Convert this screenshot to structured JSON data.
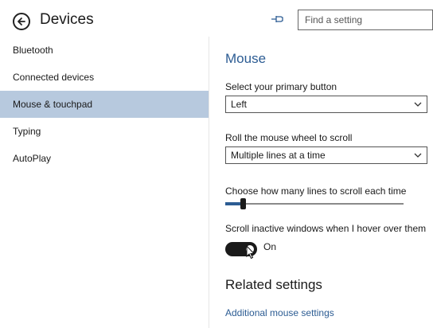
{
  "header": {
    "title": "Devices",
    "search_placeholder": "Find a setting"
  },
  "sidebar": {
    "items": [
      {
        "label": "Bluetooth",
        "selected": false
      },
      {
        "label": "Connected devices",
        "selected": false
      },
      {
        "label": "Mouse & touchpad",
        "selected": true
      },
      {
        "label": "Typing",
        "selected": false
      },
      {
        "label": "AutoPlay",
        "selected": false
      }
    ]
  },
  "main": {
    "section_title": "Mouse",
    "primary_button": {
      "label": "Select your primary button",
      "value": "Left"
    },
    "scroll_wheel": {
      "label": "Roll the mouse wheel to scroll",
      "value": "Multiple lines at a time"
    },
    "scroll_lines": {
      "label": "Choose how many lines to scroll each time",
      "value_fraction": 0.1
    },
    "inactive_scroll": {
      "label": "Scroll inactive windows when I hover over them",
      "state": "On"
    },
    "related": {
      "title": "Related settings",
      "link": "Additional mouse settings"
    }
  },
  "colors": {
    "accent": "#2c5c93",
    "selected_bg": "#b7c9de"
  }
}
